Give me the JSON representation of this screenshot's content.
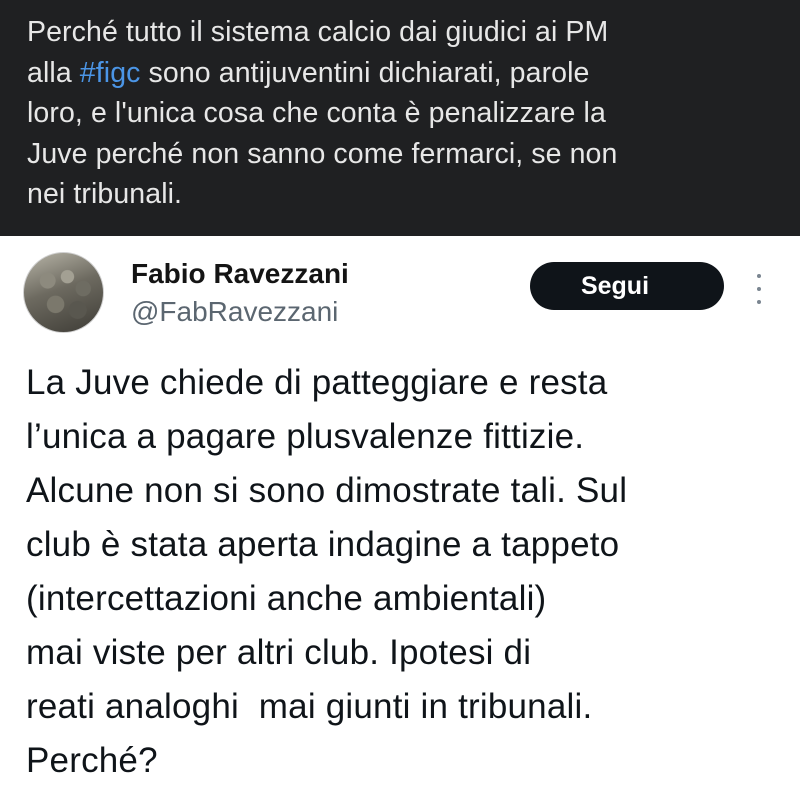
{
  "caption": {
    "line1": "Perché tutto il sistema calcio dai giudici ai PM",
    "line2_pre": "alla ",
    "line2_hashtag": "#figc",
    "line2_post": " sono antijuventini dichiarati, parole",
    "line3": "loro, e l'unica cosa che conta è penalizzare la",
    "line4": "Juve perché non sanno come fermarci, se non",
    "line5": "nei tribunali."
  },
  "tweet": {
    "author_name": "Fabio Ravezzani",
    "author_handle": "@FabRavezzani",
    "follow_label": "Segui",
    "lines": [
      "La Juve chiede di patteggiare e resta",
      "l’unica a pagare plusvalenze fittizie.",
      "Alcune non si sono dimostrate tali. Sul",
      "club è stata aperta indagine a tappeto",
      "(intercettazioni anche ambientali)",
      "mai viste per altri club. Ipotesi di",
      "reati analoghi  mai giunti in tribunali.",
      "Perché?"
    ]
  },
  "colors": {
    "caption_bg": "#1f2022",
    "hashtag": "#4b95e6",
    "follow_button": "#0f1419"
  },
  "icons": {
    "avatar": "profile-photo",
    "more": "more-options-vertical-dots-icon"
  }
}
